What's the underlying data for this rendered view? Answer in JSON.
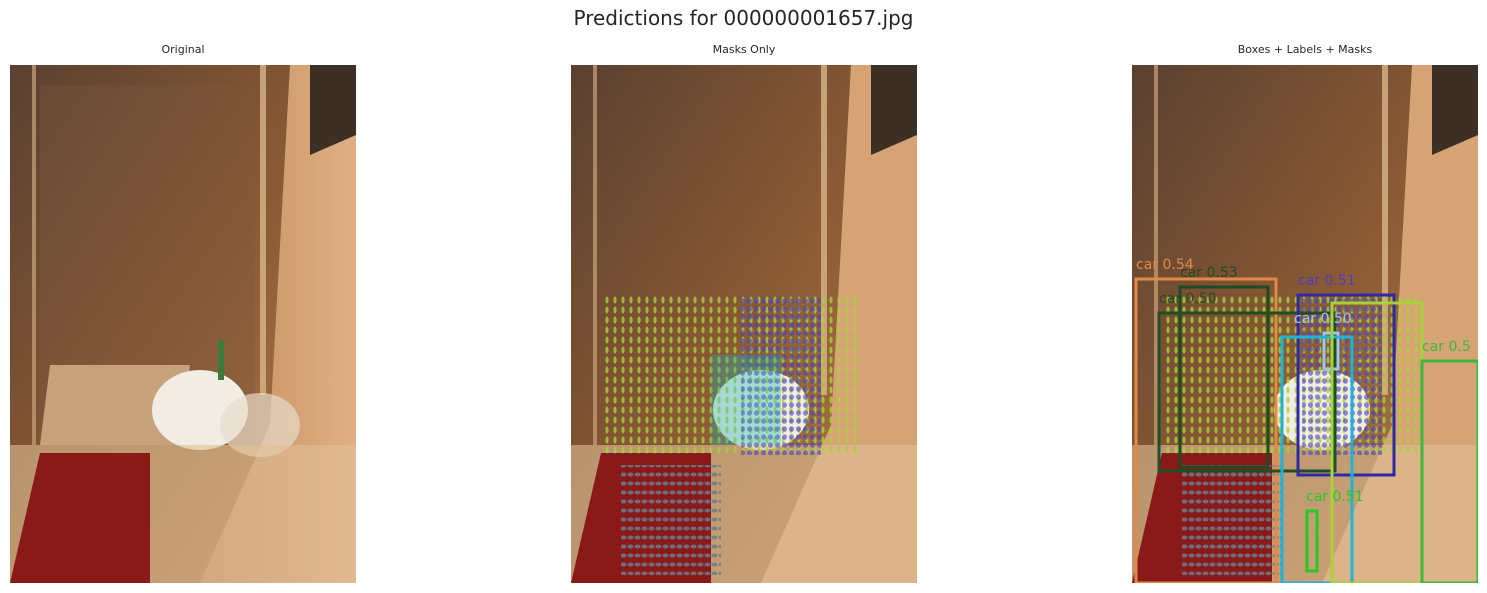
{
  "figure": {
    "title": "Predictions for 000000001657.jpg"
  },
  "panels": [
    {
      "title": "Original"
    },
    {
      "title": "Masks Only"
    },
    {
      "title": "Boxes + Labels + Masks"
    }
  ],
  "detections": [
    {
      "label": "car 0.54"
    },
    {
      "label": "car 0.53"
    },
    {
      "label": "car 0.51"
    },
    {
      "label": "car 0.50"
    },
    {
      "label": "car 0.50"
    },
    {
      "label": "car 0.51"
    },
    {
      "label": "car 0.5"
    }
  ],
  "colors": {
    "wall": "#8a5a2e",
    "rug": "#8a1a1a",
    "sink": "#f2ede4",
    "mask_green": "#a8d23a",
    "mask_teal": "#1fb3b3",
    "mask_purple": "#4a3fbf",
    "mask_slate": "#6b7a8a"
  }
}
